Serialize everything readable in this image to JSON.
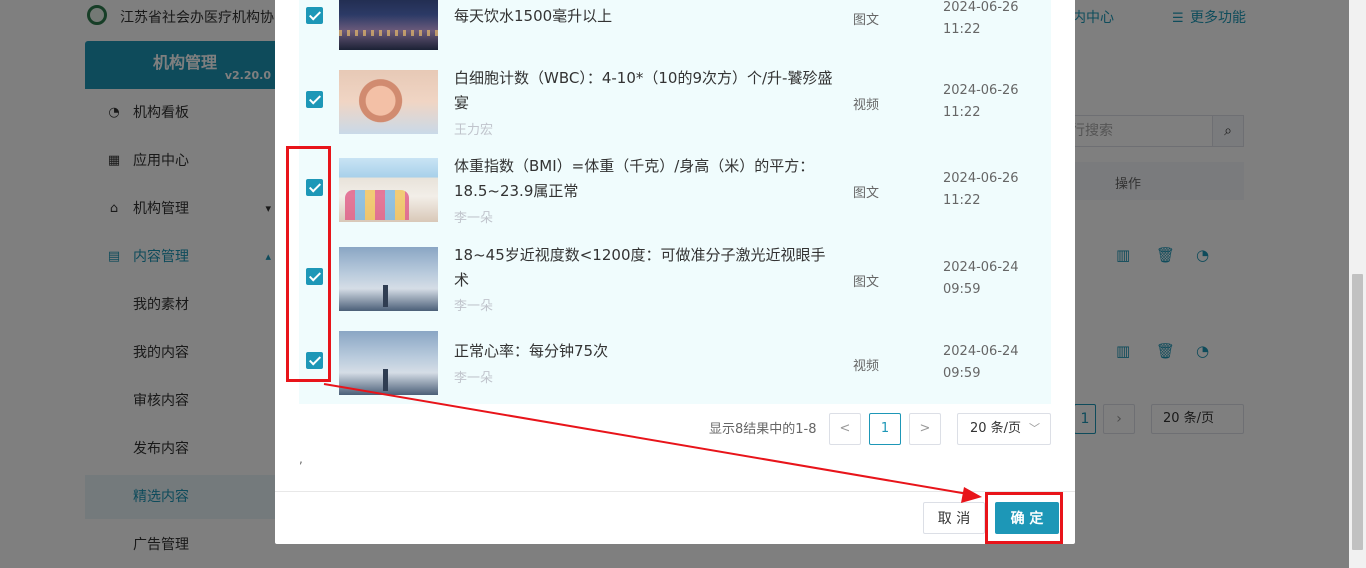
{
  "background": {
    "org_name": "江苏省社会办医疗机构协",
    "top_links": [
      "内中心",
      "更多功能"
    ],
    "sidebar": {
      "title": "机构管理",
      "version": "v2.20.0",
      "items": [
        {
          "label": "机构看板",
          "icon": "pie-chart-icon"
        },
        {
          "label": "应用中心",
          "icon": "grid-icon"
        },
        {
          "label": "机构管理",
          "icon": "bank-icon",
          "arrow": "▾"
        },
        {
          "label": "内容管理",
          "icon": "document-icon",
          "arrow": "▴"
        },
        {
          "label": "我的素材"
        },
        {
          "label": "我的内容"
        },
        {
          "label": "审核内容"
        },
        {
          "label": "发布内容"
        },
        {
          "label": "精选内容"
        },
        {
          "label": "广告管理"
        }
      ]
    },
    "search_placeholder": "行搜索",
    "table_op_header": "操作",
    "pager": {
      "current": "1",
      "size": "20 条/页"
    }
  },
  "modal": {
    "rows": [
      {
        "title": "每天饮水1500毫升以上",
        "author": "",
        "type": "图文",
        "date": "2024-06-26",
        "time": "11:22",
        "thumb": "night"
      },
      {
        "title": "白细胞计数（WBC）：4-10*（10的9次方）个/升-饕殄盛宴",
        "author": "王力宏",
        "type": "视频",
        "date": "2024-06-26",
        "time": "11:22",
        "thumb": "bear"
      },
      {
        "title": "体重指数（BMI）=体重（千克）/身高（米）的平方：18.5~23.9属正常",
        "author": "李一朵",
        "type": "图文",
        "date": "2024-06-26",
        "time": "11:22",
        "thumb": "kids"
      },
      {
        "title": "18~45岁近视度数<1200度：可做准分子激光近视眼手术",
        "author": "李一朵",
        "type": "图文",
        "date": "2024-06-24",
        "time": "09:59",
        "thumb": "sky"
      },
      {
        "title": "正常心率：每分钟75次",
        "author": "李一朵",
        "type": "视频",
        "date": "2024-06-24",
        "time": "09:59",
        "thumb": "sky"
      }
    ],
    "pager": {
      "total_text": "显示8结果中的1-8",
      "current": "1",
      "prev": "<",
      "next": ">",
      "size": "20 条/页"
    },
    "stray_mark": ",",
    "cancel_label": "取 消",
    "confirm_label": "确 定"
  },
  "colors": {
    "accent": "#1d97b7",
    "annotation": "#e8141a"
  }
}
